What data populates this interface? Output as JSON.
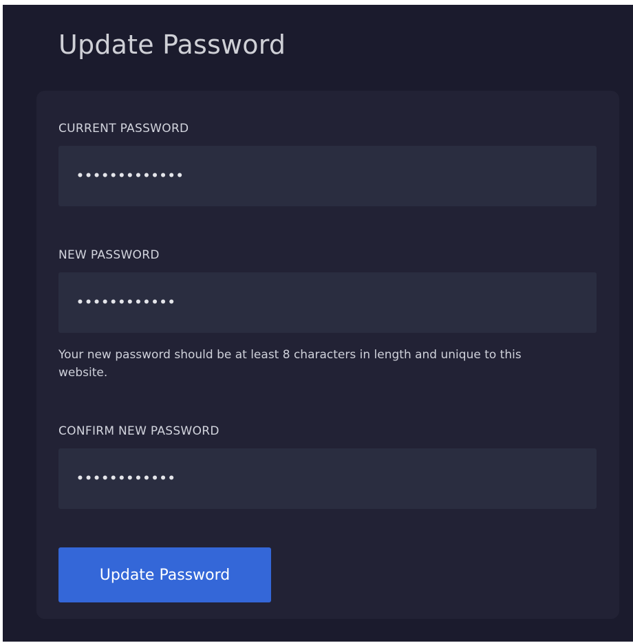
{
  "page": {
    "title": "Update Password"
  },
  "form": {
    "current_password": {
      "label": "CURRENT PASSWORD",
      "value": "•••••••••••••"
    },
    "new_password": {
      "label": "NEW PASSWORD",
      "value": "••••••••••••",
      "help": "Your new password should be at least 8 characters in length and unique to this website."
    },
    "confirm_password": {
      "label": "CONFIRM NEW PASSWORD",
      "value": "••••••••••••"
    },
    "submit_label": "Update Password"
  },
  "colors": {
    "page_background": "#1b1b2d",
    "card_background": "#222235",
    "input_background": "#2a2d40",
    "accent": "#3467d8"
  }
}
